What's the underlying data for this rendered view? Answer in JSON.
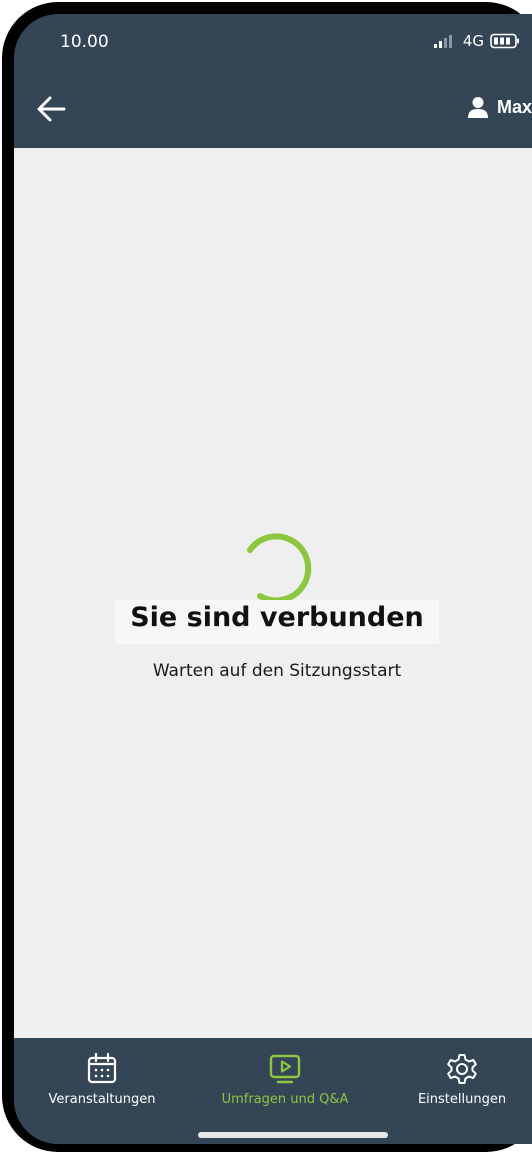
{
  "status_bar": {
    "time": "10.00",
    "network": "4G"
  },
  "header": {
    "back_icon": "arrow-left-icon",
    "user_icon": "person-icon",
    "user_name": "Max"
  },
  "main": {
    "spinner_color": "#8dc63f",
    "title": "Sie sind verbunden",
    "subtitle": "Warten auf den Sitzungsstart"
  },
  "bottom_nav": {
    "items": [
      {
        "label": "Veranstaltungen",
        "icon": "calendar-icon",
        "active": false
      },
      {
        "label": "Umfragen und Q&A",
        "icon": "play-screen-icon",
        "active": true
      },
      {
        "label": "Einstellungen",
        "icon": "gear-icon",
        "active": false
      }
    ],
    "active_color": "#8dc63f",
    "inactive_color": "#ffffff"
  },
  "colors": {
    "header_bg": "#344556",
    "content_bg": "#efefef",
    "accent": "#8dc63f"
  }
}
